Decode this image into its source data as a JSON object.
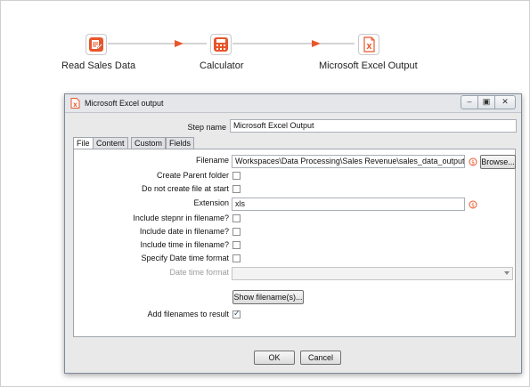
{
  "pipeline": {
    "steps": [
      {
        "label": "Read Sales Data",
        "icon": "read-sales-data-icon"
      },
      {
        "label": "Calculator",
        "icon": "calculator-icon"
      },
      {
        "label": "Microsoft Excel Output",
        "icon": "excel-output-icon"
      }
    ],
    "hop_color": "#e8562a"
  },
  "dialog": {
    "title": "Microsoft Excel output",
    "window_buttons": [
      "minimize-button",
      "restore-button",
      "close-button"
    ],
    "step_name_label": "Step name",
    "step_name_value": "Microsoft Excel Output",
    "tabs": [
      "File",
      "Content",
      "Custom",
      "Fields"
    ],
    "active_tab": "File",
    "file": {
      "filename_label": "Filename",
      "filename_value": "Workspaces\\Data Processing\\Sales Revenue\\sales_data_output",
      "browse_label": "Browse...",
      "create_parent_label": "Create Parent folder",
      "create_parent_checked": false,
      "no_create_label": "Do not create file at start",
      "no_create_checked": false,
      "extension_label": "Extension",
      "extension_value": "xls",
      "stepnr_label": "Include stepnr in filename?",
      "stepnr_checked": false,
      "date_label": "Include date in filename?",
      "date_checked": false,
      "time_label": "Include time in filename?",
      "time_checked": false,
      "specify_dt_label": "Specify Date time format",
      "specify_dt_checked": false,
      "dt_format_label": "Date time format",
      "dt_format_value": "",
      "show_filenames_label": "Show filename(s)...",
      "add_filenames_label": "Add filenames to result",
      "add_filenames_checked": true
    },
    "ok_label": "OK",
    "cancel_label": "Cancel",
    "accent_color": "#e8562a"
  }
}
